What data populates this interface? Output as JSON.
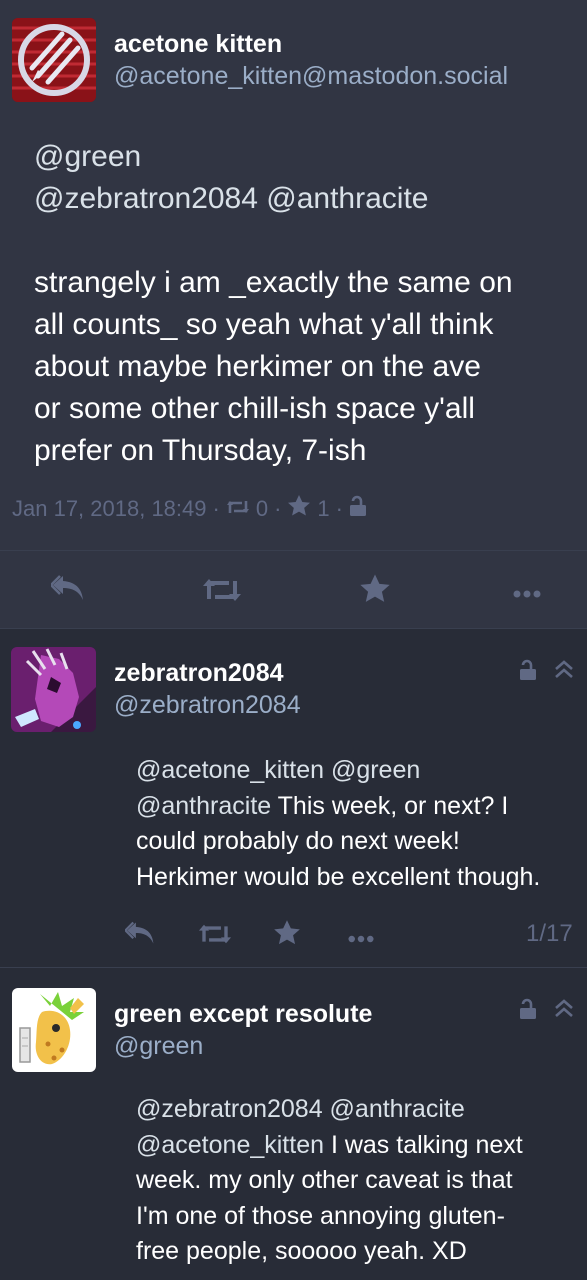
{
  "main": {
    "author": {
      "display_name": "acetone kitten",
      "handle": "@acetone_kitten@mastodon.social"
    },
    "mention_line1": "@green",
    "mention_line2": "@zebratron2084 @anthracite",
    "body_lines": [
      "strangely i am _exactly the same on",
      "all counts_ so yeah what y'all think",
      "about maybe herkimer on the ave",
      "or some other chill-ish space y'all",
      "prefer on Thursday, 7-ish"
    ],
    "meta": {
      "timestamp": "Jan 17, 2018, 18:49",
      "sep": "·",
      "boost_count": "0",
      "fav_count": "1"
    },
    "actions": {
      "reply_icon": "reply-all-icon",
      "boost_icon": "retweet-icon",
      "fav_icon": "star-icon",
      "more_icon": "ellipsis-icon"
    }
  },
  "replies": [
    {
      "display_name": "zebratron2084",
      "handle": "@zebratron2084",
      "lines": [
        {
          "mentions": "@acetone_kitten @green",
          "text": ""
        },
        {
          "mentions": "@anthracite",
          "text": " This week, or next? I"
        },
        {
          "mentions": "",
          "text": "could probably do next week!"
        },
        {
          "mentions": "",
          "text": "Herkimer would be excellent though."
        }
      ],
      "counter": "1/17"
    },
    {
      "display_name": "green except resolute",
      "handle": "@green",
      "lines": [
        {
          "mentions": "@zebratron2084 @anthracite",
          "text": ""
        },
        {
          "mentions": "@acetone_kitten",
          "text": " I was talking next"
        },
        {
          "mentions": "",
          "text": "week. my only other caveat is that"
        },
        {
          "mentions": "",
          "text": "I'm one of those annoying gluten-"
        },
        {
          "mentions": "",
          "text": "free people, sooooo yeah. XD"
        }
      ]
    }
  ],
  "colors": {
    "background": "#282c37",
    "focused_background": "#313543",
    "muted": "#606984",
    "handle": "#9baec8",
    "text": "#ffffff"
  }
}
